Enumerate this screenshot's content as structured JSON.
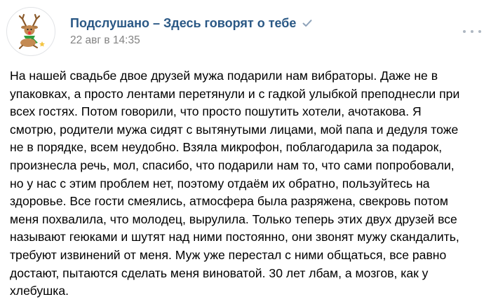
{
  "header": {
    "group_name": "Подслушано – Здесь говорят о тебе",
    "timestamp": "22 авг в 14:35",
    "avatar_icon": "reindeer-icon",
    "verified_icon": "checkmark-icon",
    "more_icon": "more-dots-icon"
  },
  "post": {
    "lines": [
      "На нашей свадьбе двое друзей мужа подарили нам вибраторы. Даже не в",
      "упаковках, а просто лентами перетянули и с гадкой улыбкой преподнесли при",
      "всех гостях. Потом говорили, что просто пошутить хотели, ачотакова. Я",
      "смотрю, родители мужа сидят с вытянутыми лицами, мой папа и дедуля тоже",
      "не в порядке, всем неудобно. Взяла микрофон, поблагодарила за подарок,",
      "произнесла речь, мол, спасибо, что подарили нам то, что сами попробовали,",
      "но у нас с этим проблем нет, поэтому отдаём их обратно, пользуйтесь на",
      "здоровье. Все гости смеялись, атмосфера была разряжена, свекровь потом",
      "меня похвалила, что молодец, вырулила. Только теперь этих двух друзей все",
      "называют геюками и шутят над ними постоянно, они звонят мужу скандалить,",
      "требуют извинений от меня. Муж уже перестал с ними общаться, все равно",
      "достают, пытаются сделать меня виноватой. 30 лет лбам, а мозгов, как у",
      "хлебушка."
    ]
  },
  "colors": {
    "link": "#2a5885",
    "meta": "#828282",
    "icon": "#aeb7c2",
    "text": "#000000"
  }
}
